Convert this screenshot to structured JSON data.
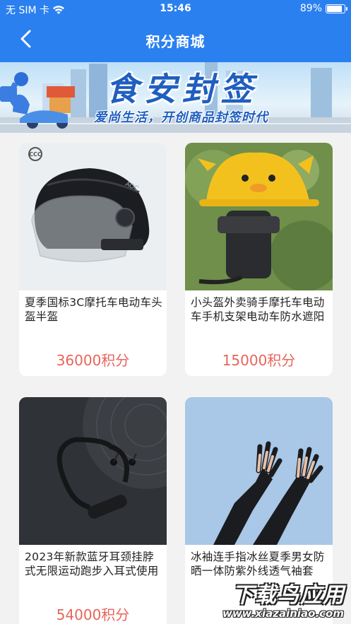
{
  "status_bar": {
    "carrier": "无 SIM 卡",
    "time": "15:46",
    "battery": "89%"
  },
  "nav": {
    "title": "积分商城",
    "back_icon": "chevron-left-icon"
  },
  "banner": {
    "title": "食安封签",
    "subtitle": "爱尚生活，开创商品封签时代"
  },
  "products": [
    {
      "name": "夏季国标3C摩托车电动车头盔半盔",
      "price": "36000积分",
      "image": "helmet",
      "badge": "国家3C认证"
    },
    {
      "name": "小头盔外卖骑手摩托车电动车手机支架电动车防水遮阳",
      "price": "15000积分",
      "image": "phone-holder"
    },
    {
      "name": "2023年新款蓝牙耳颈挂脖式无限运动跑步入耳式使用",
      "price": "54000积分",
      "image": "earphones"
    },
    {
      "name": "冰袖连手指冰丝夏季男女防晒一体防紫外线透气袖套",
      "price": "",
      "image": "sleeves"
    }
  ],
  "watermark": {
    "main": "下载鸟应用",
    "url": "www.xiazainiao.com"
  },
  "colors": {
    "header": "#2b80f0",
    "price": "#e8655a",
    "background": "#f2f2f2"
  }
}
